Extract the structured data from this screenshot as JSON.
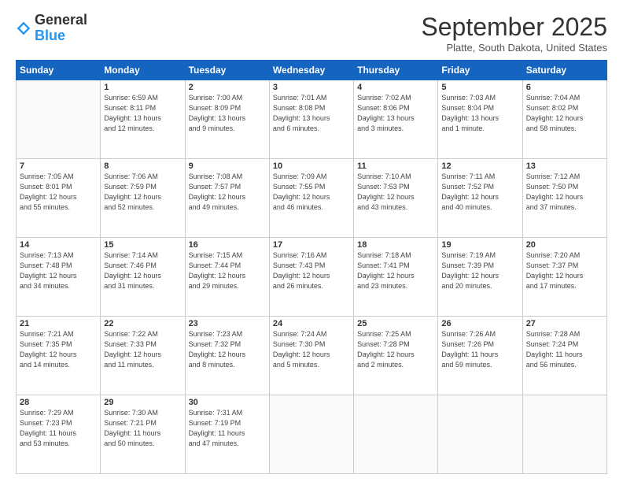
{
  "header": {
    "logo_general": "General",
    "logo_blue": "Blue",
    "month": "September 2025",
    "location": "Platte, South Dakota, United States"
  },
  "days_of_week": [
    "Sunday",
    "Monday",
    "Tuesday",
    "Wednesday",
    "Thursday",
    "Friday",
    "Saturday"
  ],
  "weeks": [
    [
      {
        "day": "",
        "info": ""
      },
      {
        "day": "1",
        "info": "Sunrise: 6:59 AM\nSunset: 8:11 PM\nDaylight: 13 hours\nand 12 minutes."
      },
      {
        "day": "2",
        "info": "Sunrise: 7:00 AM\nSunset: 8:09 PM\nDaylight: 13 hours\nand 9 minutes."
      },
      {
        "day": "3",
        "info": "Sunrise: 7:01 AM\nSunset: 8:08 PM\nDaylight: 13 hours\nand 6 minutes."
      },
      {
        "day": "4",
        "info": "Sunrise: 7:02 AM\nSunset: 8:06 PM\nDaylight: 13 hours\nand 3 minutes."
      },
      {
        "day": "5",
        "info": "Sunrise: 7:03 AM\nSunset: 8:04 PM\nDaylight: 13 hours\nand 1 minute."
      },
      {
        "day": "6",
        "info": "Sunrise: 7:04 AM\nSunset: 8:02 PM\nDaylight: 12 hours\nand 58 minutes."
      }
    ],
    [
      {
        "day": "7",
        "info": "Sunrise: 7:05 AM\nSunset: 8:01 PM\nDaylight: 12 hours\nand 55 minutes."
      },
      {
        "day": "8",
        "info": "Sunrise: 7:06 AM\nSunset: 7:59 PM\nDaylight: 12 hours\nand 52 minutes."
      },
      {
        "day": "9",
        "info": "Sunrise: 7:08 AM\nSunset: 7:57 PM\nDaylight: 12 hours\nand 49 minutes."
      },
      {
        "day": "10",
        "info": "Sunrise: 7:09 AM\nSunset: 7:55 PM\nDaylight: 12 hours\nand 46 minutes."
      },
      {
        "day": "11",
        "info": "Sunrise: 7:10 AM\nSunset: 7:53 PM\nDaylight: 12 hours\nand 43 minutes."
      },
      {
        "day": "12",
        "info": "Sunrise: 7:11 AM\nSunset: 7:52 PM\nDaylight: 12 hours\nand 40 minutes."
      },
      {
        "day": "13",
        "info": "Sunrise: 7:12 AM\nSunset: 7:50 PM\nDaylight: 12 hours\nand 37 minutes."
      }
    ],
    [
      {
        "day": "14",
        "info": "Sunrise: 7:13 AM\nSunset: 7:48 PM\nDaylight: 12 hours\nand 34 minutes."
      },
      {
        "day": "15",
        "info": "Sunrise: 7:14 AM\nSunset: 7:46 PM\nDaylight: 12 hours\nand 31 minutes."
      },
      {
        "day": "16",
        "info": "Sunrise: 7:15 AM\nSunset: 7:44 PM\nDaylight: 12 hours\nand 29 minutes."
      },
      {
        "day": "17",
        "info": "Sunrise: 7:16 AM\nSunset: 7:43 PM\nDaylight: 12 hours\nand 26 minutes."
      },
      {
        "day": "18",
        "info": "Sunrise: 7:18 AM\nSunset: 7:41 PM\nDaylight: 12 hours\nand 23 minutes."
      },
      {
        "day": "19",
        "info": "Sunrise: 7:19 AM\nSunset: 7:39 PM\nDaylight: 12 hours\nand 20 minutes."
      },
      {
        "day": "20",
        "info": "Sunrise: 7:20 AM\nSunset: 7:37 PM\nDaylight: 12 hours\nand 17 minutes."
      }
    ],
    [
      {
        "day": "21",
        "info": "Sunrise: 7:21 AM\nSunset: 7:35 PM\nDaylight: 12 hours\nand 14 minutes."
      },
      {
        "day": "22",
        "info": "Sunrise: 7:22 AM\nSunset: 7:33 PM\nDaylight: 12 hours\nand 11 minutes."
      },
      {
        "day": "23",
        "info": "Sunrise: 7:23 AM\nSunset: 7:32 PM\nDaylight: 12 hours\nand 8 minutes."
      },
      {
        "day": "24",
        "info": "Sunrise: 7:24 AM\nSunset: 7:30 PM\nDaylight: 12 hours\nand 5 minutes."
      },
      {
        "day": "25",
        "info": "Sunrise: 7:25 AM\nSunset: 7:28 PM\nDaylight: 12 hours\nand 2 minutes."
      },
      {
        "day": "26",
        "info": "Sunrise: 7:26 AM\nSunset: 7:26 PM\nDaylight: 11 hours\nand 59 minutes."
      },
      {
        "day": "27",
        "info": "Sunrise: 7:28 AM\nSunset: 7:24 PM\nDaylight: 11 hours\nand 56 minutes."
      }
    ],
    [
      {
        "day": "28",
        "info": "Sunrise: 7:29 AM\nSunset: 7:23 PM\nDaylight: 11 hours\nand 53 minutes."
      },
      {
        "day": "29",
        "info": "Sunrise: 7:30 AM\nSunset: 7:21 PM\nDaylight: 11 hours\nand 50 minutes."
      },
      {
        "day": "30",
        "info": "Sunrise: 7:31 AM\nSunset: 7:19 PM\nDaylight: 11 hours\nand 47 minutes."
      },
      {
        "day": "",
        "info": ""
      },
      {
        "day": "",
        "info": ""
      },
      {
        "day": "",
        "info": ""
      },
      {
        "day": "",
        "info": ""
      }
    ]
  ]
}
